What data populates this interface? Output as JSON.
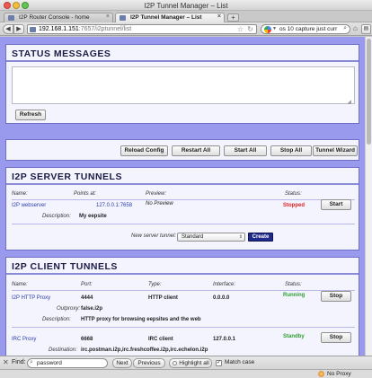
{
  "window": {
    "title": "I2P Tunnel Manager – List"
  },
  "tabs": [
    {
      "label": "I2P Router Console - home",
      "active": false
    },
    {
      "label": "I2P Tunnel Manager – List",
      "active": true
    }
  ],
  "navbar": {
    "url_host": "192.168.1.151",
    "url_rest": ":7657/i2ptunnel/list",
    "search_text": "os 10 capture just curr"
  },
  "status_messages": {
    "title": "STATUS MESSAGES",
    "textarea_value": "",
    "refresh_label": "Refresh"
  },
  "controls": {
    "reload_config": "Reload Config",
    "restart_all": "Restart All",
    "start_all": "Start All",
    "stop_all": "Stop All",
    "tunnel_wizard": "Tunnel Wizard"
  },
  "server_tunnels": {
    "title": "I2P SERVER TUNNELS",
    "headers": {
      "name": "Name:",
      "points_at": "Points at:",
      "preview": "Preview:",
      "status": "Status:"
    },
    "rows": [
      {
        "name": "I2P webserver",
        "points_at": "127.0.0.1:7658",
        "preview": "No Preview",
        "status": "Stopped",
        "action": "Start",
        "description_label": "Description:",
        "description": "My eepsite"
      }
    ],
    "new_server_label": "New server tunnel:",
    "new_server_type": "Standard",
    "create_label": "Create"
  },
  "client_tunnels": {
    "title": "I2P CLIENT TUNNELS",
    "headers": {
      "name": "Name:",
      "port": "Port:",
      "type": "Type:",
      "interface": "Interface:",
      "status": "Status:"
    },
    "rows": [
      {
        "name": "I2P HTTP Proxy",
        "port": "4444",
        "type": "HTTP client",
        "interface": "0.0.0.0",
        "status": "Running",
        "action": "Stop",
        "extra_label": "Outproxy:",
        "extra_value": "false.i2p",
        "description_label": "Description:",
        "description": "HTTP proxy for browsing eepsites and the web"
      },
      {
        "name": "IRC Proxy",
        "port": "6668",
        "type": "IRC client",
        "interface": "127.0.0.1",
        "status": "Standby",
        "action": "Stop",
        "extra_label": "Destination:",
        "extra_value": "irc.postman.i2p,irc.freshcoffee.i2p,irc.echelon.i2p"
      }
    ]
  },
  "findbar": {
    "label": "Find:",
    "query": "password",
    "next": "Next",
    "previous": "Previous",
    "highlight_all": "Highlight all",
    "match_case": "Match case",
    "match_case_checked": true
  },
  "statusbar": {
    "proxy_label": "No Proxy"
  }
}
